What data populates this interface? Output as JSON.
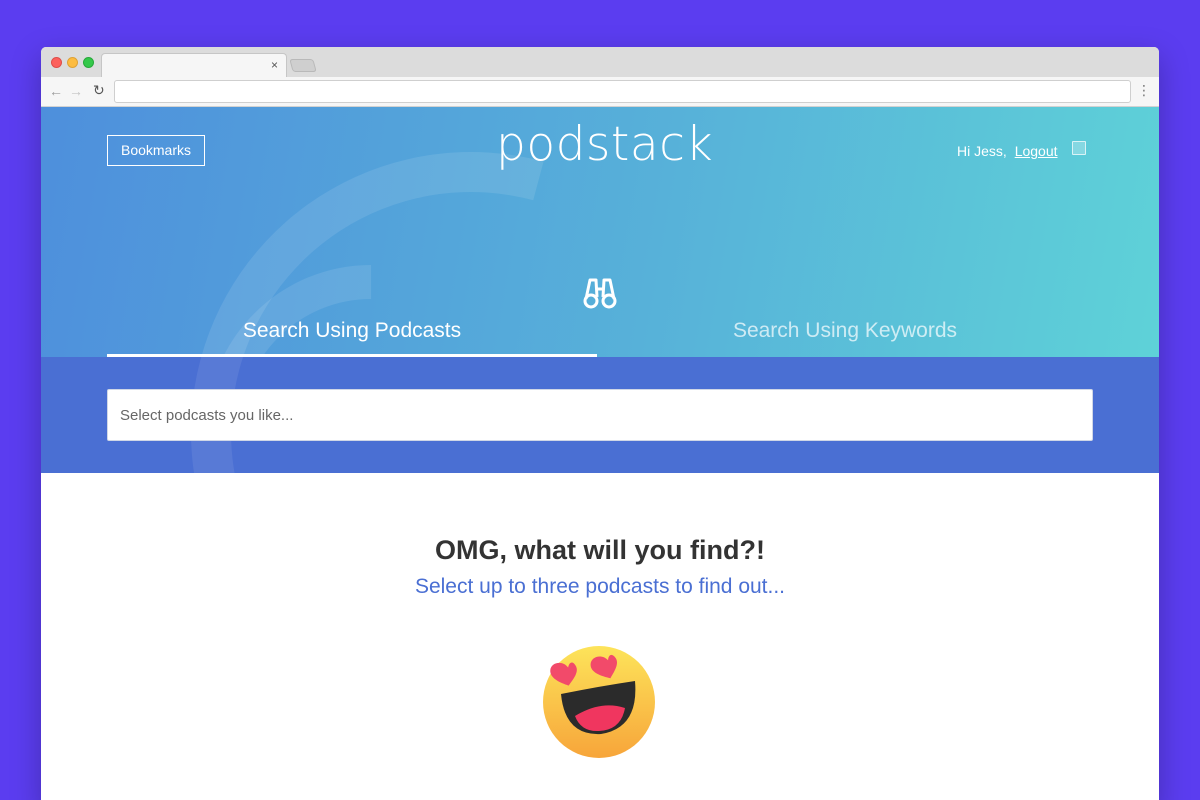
{
  "browser": {
    "tab_close": "×",
    "nav_back": "←",
    "nav_forward": "→",
    "nav_reload": "↻",
    "menu": "⋮",
    "address": ""
  },
  "header": {
    "bookmarks_label": "Bookmarks",
    "logo": "podstack",
    "greeting": "Hi Jess,",
    "logout_label": "Logout"
  },
  "search_tabs": {
    "items": [
      {
        "label": "Search Using Podcasts",
        "active": true
      },
      {
        "label": "Search Using Keywords",
        "active": false
      }
    ],
    "icon": "binoculars-icon"
  },
  "search": {
    "placeholder": "Select podcasts you like..."
  },
  "main": {
    "headline": "OMG, what will you find?!",
    "subline": "Select up to three podcasts to find out...",
    "emoji_icon": "heart-eyes-emoji-icon"
  },
  "colors": {
    "page_bg": "#5b3df0",
    "hero_start": "#4e8fdc",
    "hero_end": "#5ed2d8",
    "band": "#4a6fd3",
    "accent_text": "#4a6fd3"
  }
}
